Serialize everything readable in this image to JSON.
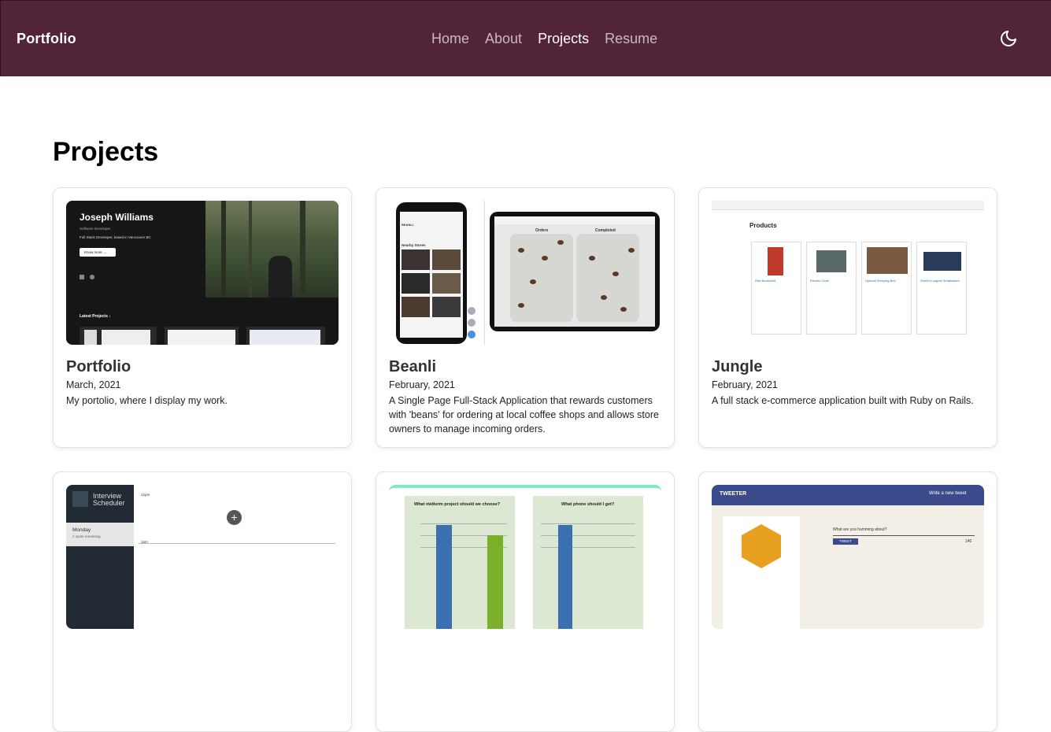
{
  "nav": {
    "brand": "Portfolio",
    "links": [
      {
        "label": "Home",
        "active": false
      },
      {
        "label": "About",
        "active": false
      },
      {
        "label": "Projects",
        "active": true
      },
      {
        "label": "Resume",
        "active": false
      }
    ],
    "theme_icon": "moon-icon"
  },
  "page": {
    "title": "Projects"
  },
  "projects": [
    {
      "title": "Portfolio",
      "date": "March, 2021",
      "description": "My portolio, where I display my work.",
      "thumb": {
        "name": "Joseph Williams",
        "subtitle": "Software Developer",
        "tagline": "Full Stack Developer, based in Vancouver BC",
        "button": "Know more →",
        "section": "Latest Projects ↓"
      }
    },
    {
      "title": "Beanli",
      "date": "February, 2021",
      "description": "A Single Page Full-Stack Application that rewards customers with 'beans' for ordering at local coffee shops and allows store owners to manage incoming orders.",
      "thumb": {
        "logo": "BEANLI",
        "nearby": "Nearby Stores",
        "orders": "Orders",
        "completed": "Completed"
      }
    },
    {
      "title": "Jungle",
      "date": "February, 2021",
      "description": "A full stack e-commerce application built with Ruby on Rails.",
      "thumb": {
        "heading": "Products",
        "items": [
          "Red Bookshelf",
          "Electric Chair",
          "Optimal Sleeping Bed",
          "World's Largest Smartwatch"
        ]
      }
    },
    {
      "thumb": {
        "app": "Interview Scheduler",
        "day": "Monday",
        "spots": "2 spots remaining",
        "time1": "12pm",
        "time2": "1pm"
      }
    },
    {
      "thumb": {
        "chart1": "What midterm project should we choose?",
        "chart2": "What phone should I get?"
      }
    },
    {
      "thumb": {
        "logo": "TWEETER",
        "compose": "Write a new tweet",
        "prompt": "What are you humming about?",
        "button": "TWEET",
        "count": "140"
      }
    }
  ],
  "colors": {
    "navbar": "#52243a",
    "accent": "#ffffff"
  }
}
